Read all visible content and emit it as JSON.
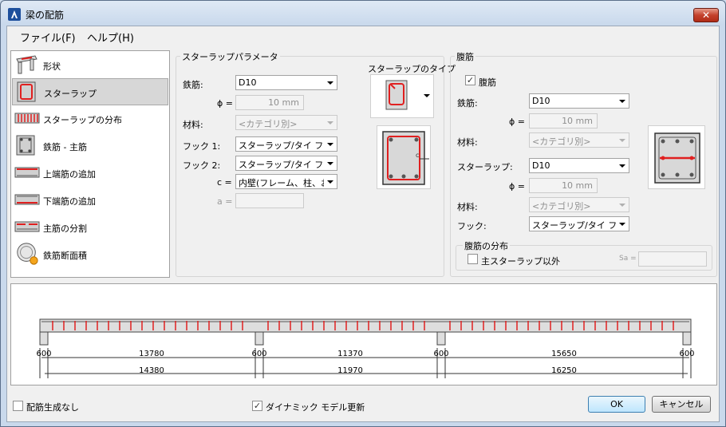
{
  "window": {
    "title": "梁の配筋",
    "close_symbol": "✕"
  },
  "menu": {
    "file": "ファイル(F)",
    "help": "ヘルプ(H)"
  },
  "nav": {
    "items": [
      {
        "label": "形状",
        "icon": "shape-icon"
      },
      {
        "label": "スターラップ",
        "icon": "stirrup-icon",
        "selected": true
      },
      {
        "label": "スターラップの分布",
        "icon": "stirrup-distribution-icon"
      },
      {
        "label": "鉄筋 - 主筋",
        "icon": "main-bar-icon"
      },
      {
        "label": "上端筋の追加",
        "icon": "top-bar-icon"
      },
      {
        "label": "下端筋の追加",
        "icon": "bottom-bar-icon"
      },
      {
        "label": "主筋の分割",
        "icon": "bar-split-icon"
      },
      {
        "label": "鉄筋断面積",
        "icon": "rebar-area-icon"
      }
    ]
  },
  "stirrup_params": {
    "group_title": "スターラップパラメータ",
    "rebar_label": "鉄筋:",
    "rebar_value": "D10",
    "phi_label": "ϕ =",
    "phi_value": "10 mm",
    "material_label": "材料:",
    "material_value": "<カテゴリ別>",
    "hook1_label": "フック 1:",
    "hook1_value": "スターラップ/タイ フッ",
    "hook2_label": "フック 2:",
    "hook2_value": "スターラップ/タイ フッ",
    "c_label": "c =",
    "c_value": "内壁(フレーム、柱、お.",
    "a_label": "a ="
  },
  "stirrup_type": {
    "label": "スターラップのタイプ",
    "c_marker": "c"
  },
  "web_bar": {
    "group_title": "腹筋",
    "checkbox_label": "腹筋",
    "checked": true,
    "rebar_label": "鉄筋:",
    "rebar_value": "D10",
    "phi_label": "ϕ =",
    "phi_value": "10 mm",
    "material_label": "材料:",
    "material_value": "<カテゴリ別>",
    "stirrup_label": "スターラップ:",
    "stirrup_value": "D10",
    "phi2_label": "ϕ =",
    "phi2_value": "10 mm",
    "material2_label": "材料:",
    "material2_value": "<カテゴリ別>",
    "hook_label": "フック:",
    "hook_value": "スターラップ/タイ フッ",
    "distribution_title": "腹筋の分布",
    "except_main_label": "主スターラップ以外",
    "except_main_checked": false,
    "sa_label": "Sa ="
  },
  "beam_preview": {
    "support_labels": [
      "600",
      "600",
      "600",
      "600"
    ],
    "clear_spans": [
      "13780",
      "11370",
      "15650"
    ],
    "full_spans": [
      "14380",
      "11970",
      "16250"
    ]
  },
  "footer": {
    "no_generation_label": "配筋生成なし",
    "no_generation_checked": false,
    "dynamic_update_label": "ダイナミック モデル更新",
    "dynamic_update_checked": true,
    "ok_label": "OK",
    "cancel_label": "キャンセル"
  },
  "colors": {
    "rebar_red": "#e02020",
    "accent": "#3c7fb1"
  }
}
